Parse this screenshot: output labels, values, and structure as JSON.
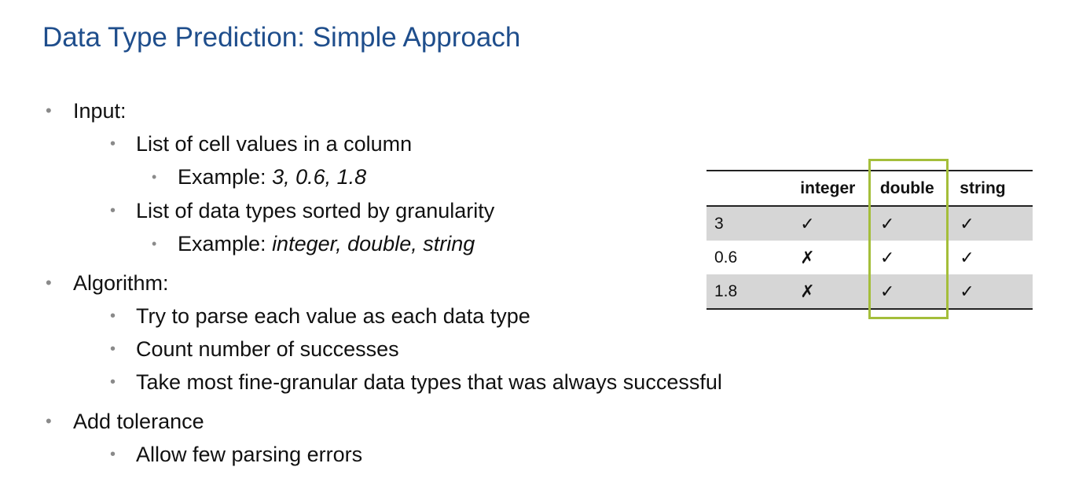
{
  "title": "Data Type Prediction: Simple Approach",
  "bullets": {
    "input": "Input:",
    "input_cells": "List of cell values in a column",
    "input_cells_example_label": "Example: ",
    "input_cells_example_value": "3, 0.6, 1.8",
    "input_types": "List of data types sorted by granularity",
    "input_types_example_label": "Example: ",
    "input_types_example_value": "integer, double, string",
    "algorithm": "Algorithm:",
    "algo_step1": "Try to parse each value as each data type",
    "algo_step2": "Count number of successes",
    "algo_step3": "Take most fine-granular data types that was always successful",
    "tolerance": "Add tolerance",
    "tolerance_detail": "Allow few parsing errors",
    "bullet_glyph": "•"
  },
  "table": {
    "headers": [
      "",
      "integer",
      "double",
      "string"
    ],
    "rows": [
      [
        "3",
        "✓",
        "✓",
        "✓"
      ],
      [
        "0.6",
        "✗",
        "✓",
        "✓"
      ],
      [
        "1.8",
        "✗",
        "✓",
        "✓"
      ]
    ],
    "highlighted_column": "double",
    "highlight_color": "#a4be3a",
    "shade_color": "#d6d6d6"
  },
  "colors": {
    "title": "#1f4e8c",
    "bullet": "#8a8a8a"
  }
}
